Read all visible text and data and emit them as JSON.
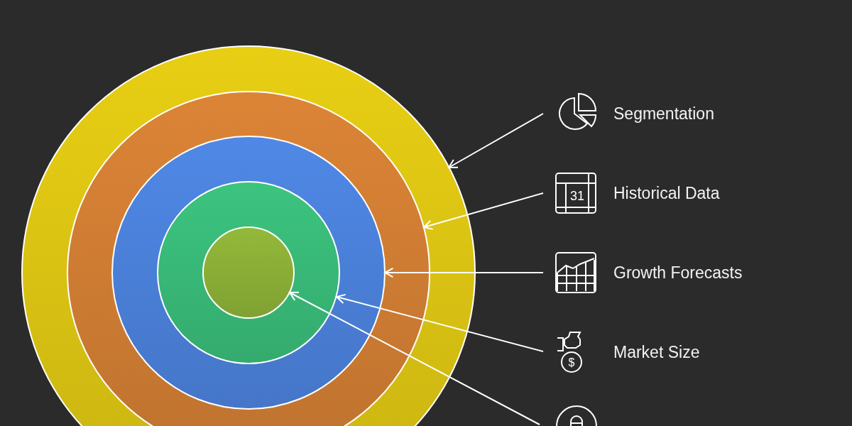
{
  "rings": [
    {
      "color": "#e8cf14"
    },
    {
      "color": "#dc8436"
    },
    {
      "color": "#4f88e6"
    },
    {
      "color": "#3cc47f"
    },
    {
      "color": "#93b93a"
    }
  ],
  "labels": [
    {
      "label": "Segmentation",
      "kind": "pie"
    },
    {
      "label": "Historical Data",
      "kind": "calendar",
      "icon_text": "31"
    },
    {
      "label": "Growth Forecasts",
      "kind": "chart"
    },
    {
      "label": "Market Size",
      "kind": "moneybag",
      "icon_text": "$"
    }
  ]
}
